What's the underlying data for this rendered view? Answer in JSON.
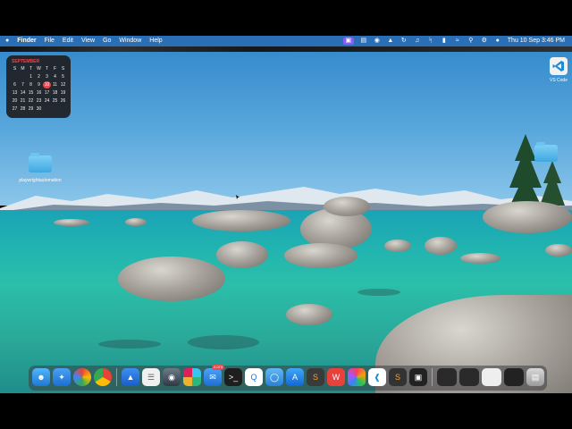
{
  "menubar": {
    "apple": "",
    "app_name": "Finder",
    "menus": [
      "File",
      "Edit",
      "View",
      "Go",
      "Window",
      "Help"
    ],
    "clock": "Thu 10 Sep  3:46 PM"
  },
  "calendar": {
    "month": "SEPTEMBER",
    "weekdays": [
      "S",
      "M",
      "T",
      "W",
      "T",
      "F",
      "S"
    ],
    "days": [
      "",
      "",
      "1",
      "2",
      "3",
      "4",
      "5",
      "6",
      "7",
      "8",
      "9",
      "10",
      "11",
      "12",
      "13",
      "14",
      "15",
      "16",
      "17",
      "18",
      "19",
      "20",
      "21",
      "22",
      "23",
      "24",
      "25",
      "26",
      "27",
      "28",
      "29",
      "30",
      "",
      "",
      ""
    ],
    "today": "10"
  },
  "desktop": {
    "folder_label": "playwrightautomation",
    "vscode_label": "VS Code"
  },
  "dock": {
    "mail_badge": "2,073"
  }
}
